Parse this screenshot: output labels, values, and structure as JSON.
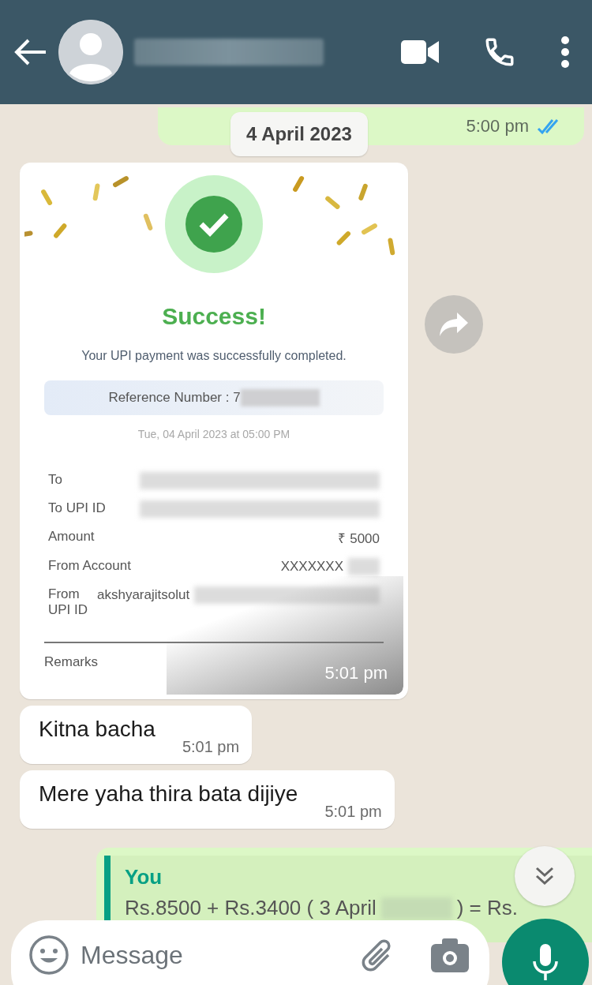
{
  "header": {
    "contact_name_redacted": true
  },
  "top_message": {
    "time": "5:00 pm",
    "read": true
  },
  "date_chip": "4 April 2023",
  "receipt": {
    "title": "Success!",
    "subtitle": "Your UPI payment was successfully completed.",
    "reference": "Reference Number : 7",
    "reference_redacted": true,
    "datetime": "Tue, 04 April 2023 at 05:00 PM",
    "rows": [
      {
        "label": "To",
        "redacted": true
      },
      {
        "label": "To UPI ID",
        "redacted": true
      },
      {
        "label": "Amount",
        "value": "₹ 5000",
        "redacted": false
      },
      {
        "label": "From Account",
        "value": "XXXXXXX",
        "redacted": true
      },
      {
        "label": "From\nUPI ID",
        "value": "akshyarajitsolut",
        "redacted": true
      }
    ],
    "remarks_label": "Remarks",
    "time": "5:01 pm"
  },
  "incoming": [
    {
      "text": "Kitna bacha",
      "time": "5:01 pm"
    },
    {
      "text": "Mere yaha thira bata dijiye",
      "time": "5:01 pm"
    }
  ],
  "outgoing_reply": {
    "quote_author": "You",
    "quote_parts": [
      "Rs.8500 + Rs.3400 ( 3 April",
      ") = Rs."
    ]
  },
  "composer": {
    "placeholder": "Message"
  }
}
